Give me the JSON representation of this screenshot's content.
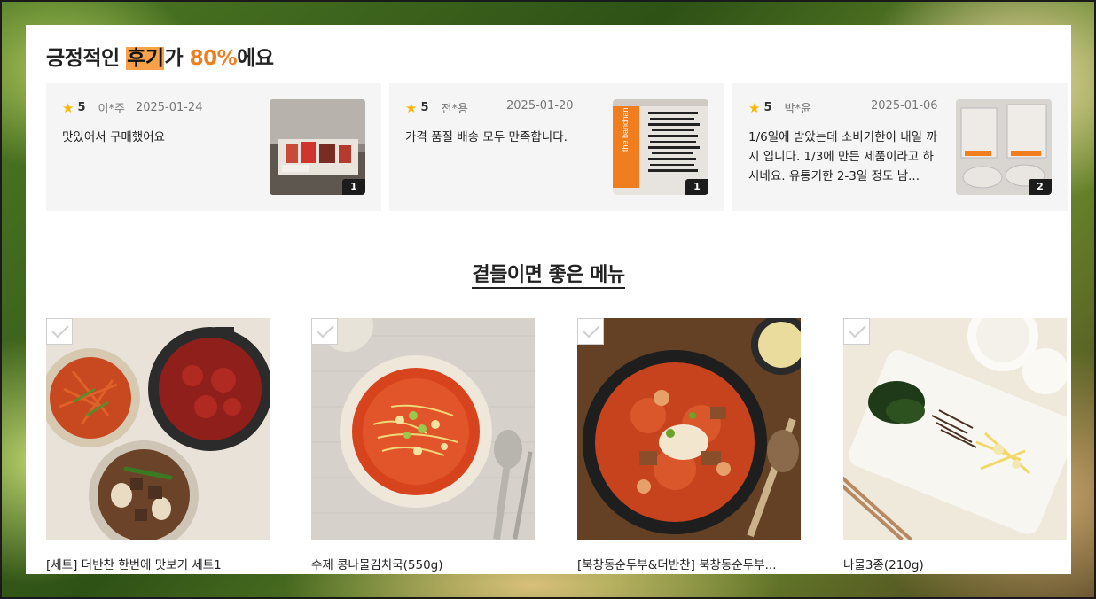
{
  "reviews": {
    "title_prefix": "긍정적인 ",
    "title_highlight": "후기",
    "title_mid": "가 ",
    "title_percent": "80%",
    "title_suffix": "에요",
    "items": [
      {
        "rating": "5",
        "author": "이*주",
        "date": "2025-01-24",
        "text": "맛있어서 구매했어요",
        "photo_count": "1"
      },
      {
        "rating": "5",
        "author": "전*용",
        "date": "2025-01-20",
        "text": "가격 품질 배송 모두 만족합니다.",
        "photo_count": "1"
      },
      {
        "rating": "5",
        "author": "박*윤",
        "date": "2025-01-06",
        "text": "1/6일에 받았는데 소비기한이 내일 까지 입니다. 1/3에 만든 제품이라고 하시네요. 유통기한 2-3일 정도 남...",
        "photo_count": "2"
      }
    ]
  },
  "recommend": {
    "title": "곁들이면 좋은 메뉴",
    "products": [
      {
        "name": "[세트] 더반찬 한번에 맛보기 세트1"
      },
      {
        "name": "수제 콩나물김치국(550g)"
      },
      {
        "name": "[북창동순두부&더반찬] 북창동순두부..."
      },
      {
        "name": "나물3종(210g)"
      }
    ]
  },
  "colors": {
    "accent": "#f07d1e",
    "highlight": "#f7a24a",
    "star": "#f5b800"
  }
}
